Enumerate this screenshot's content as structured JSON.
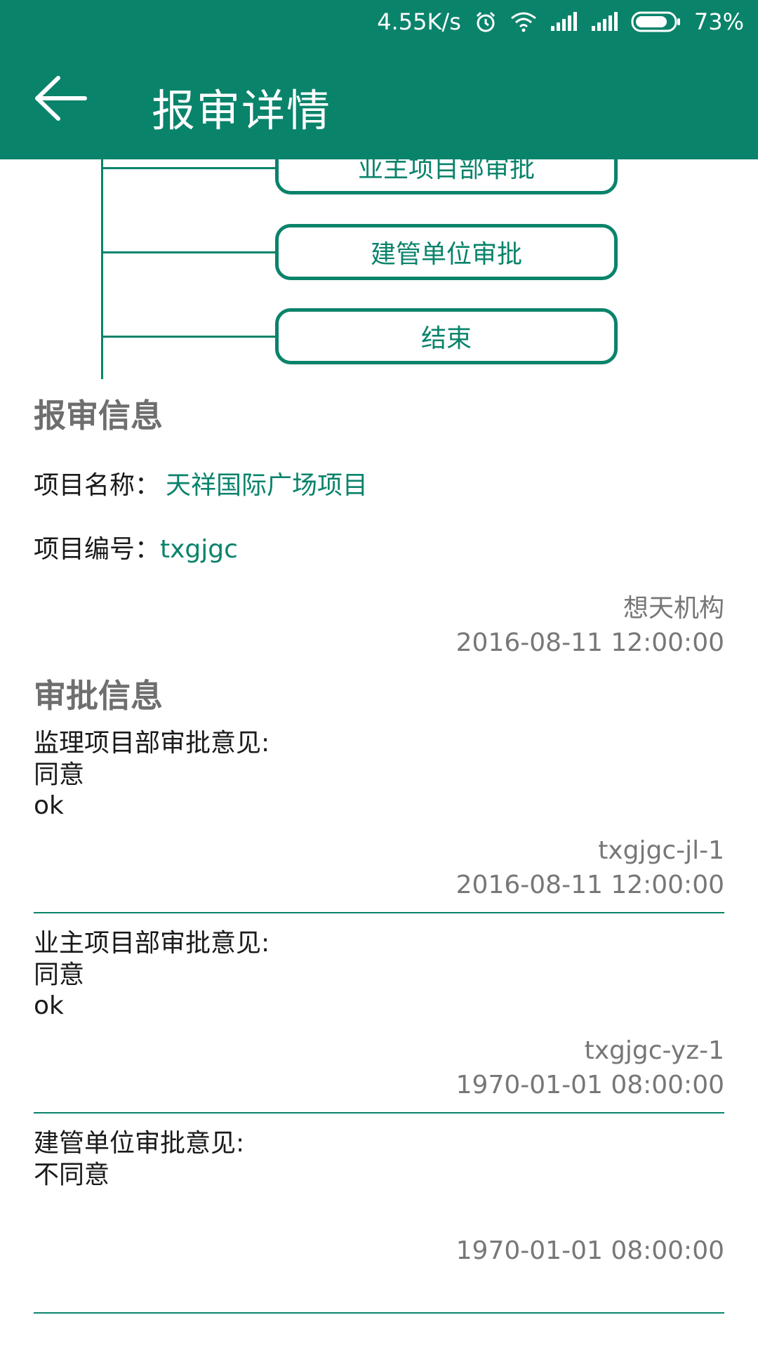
{
  "status_bar": {
    "speed": "4.55K/s",
    "battery": "73%"
  },
  "header": {
    "title": "报审详情"
  },
  "flow": {
    "nodes": [
      "业主项目部审批",
      "建管单位审批",
      "结束"
    ]
  },
  "report_info": {
    "section_title": "报审信息",
    "project_name_label": "项目名称：",
    "project_name_value": "天祥国际广场项目",
    "project_code_label": "项目编号：",
    "project_code_value": "txgjgc",
    "org": "想天机构",
    "time": "2016-08-11 12:00:00"
  },
  "approval_info": {
    "section_title": "审批信息",
    "items": [
      {
        "label": "监理项目部审批意见:",
        "decision": "同意",
        "comment": "ok",
        "user": "txgjgc-jl-1",
        "time": "2016-08-11 12:00:00"
      },
      {
        "label": "业主项目部审批意见:",
        "decision": "同意",
        "comment": "ok",
        "user": "txgjgc-yz-1",
        "time": "1970-01-01 08:00:00"
      },
      {
        "label": "建管单位审批意见:",
        "decision": "不同意",
        "comment": "",
        "user": "",
        "time": "1970-01-01 08:00:00"
      }
    ]
  },
  "colors": {
    "primary": "#0a836b",
    "muted": "#777777"
  },
  "icons": [
    "back-arrow-icon",
    "alarm-icon",
    "wifi-icon",
    "signal-icon",
    "battery-icon"
  ]
}
